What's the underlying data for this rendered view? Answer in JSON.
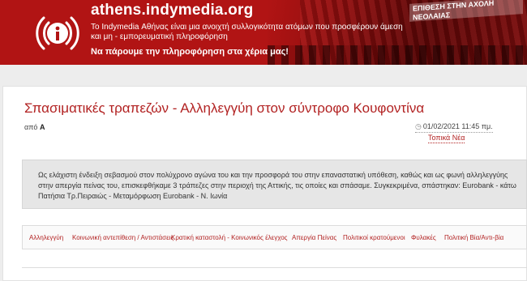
{
  "header": {
    "site_title": "athens.indymedia.org",
    "tagline": "Το Indymedia Αθήνας είναι μια ανοιχτή συλλογικότητα ατόμων που προσφέρουν άμεση και μη - εμπορευματική πληροφόρηση",
    "slogan": "Να πάρουμε την πληροφόρηση στα χέρια μας!",
    "photo_sign": "ΕΠΙΘΕΣΗ ΣΤΗΝ ΑΧΟΛΗ ΝΕΟΛΑΙΑΣ"
  },
  "article": {
    "title": "Σπασιματικές τραπεζών - Αλληλεγγύη στον σύντροφο Κουφοντίνα",
    "author_prefix": "από",
    "author": "Α",
    "date": "01/02/2021 11:45 πμ.",
    "category": "Τοπικά Νέα",
    "body": "Ως ελάχιστη ένδειξη σεβασμού στον πολύχρονο αγώνα του και την προσφορά του στην επαναστατική υπόθεση, καθώς και ως φωνή αλληλεγγύης στην απεργία πείνας του, επισκεφθήκαμε 3 τράπεζες στην περιοχή της Αττικής, τις οποίες και σπάσαμε. Συγκεκριμένα, σπάστηκαν: Eurobank - κάτω Πατήσια Τρ.Πειραιώς - Μεταμόρφωση Eurobank - Ν. Ιωνία"
  },
  "tags": [
    "Αλληλεγγύη",
    "Κοινωνική αντεπίθεση / Αντιστάσεις",
    "Κρατική καταστολή - Κοινωνικός έλεγχος",
    "Απεργία Πείνας",
    "Πολιτικοί κρατούμενοι",
    "Φυλακές",
    "Πολιτική Βία/Αντι-βία"
  ],
  "colors": {
    "banner": "#b11414",
    "accent": "#b22222"
  }
}
